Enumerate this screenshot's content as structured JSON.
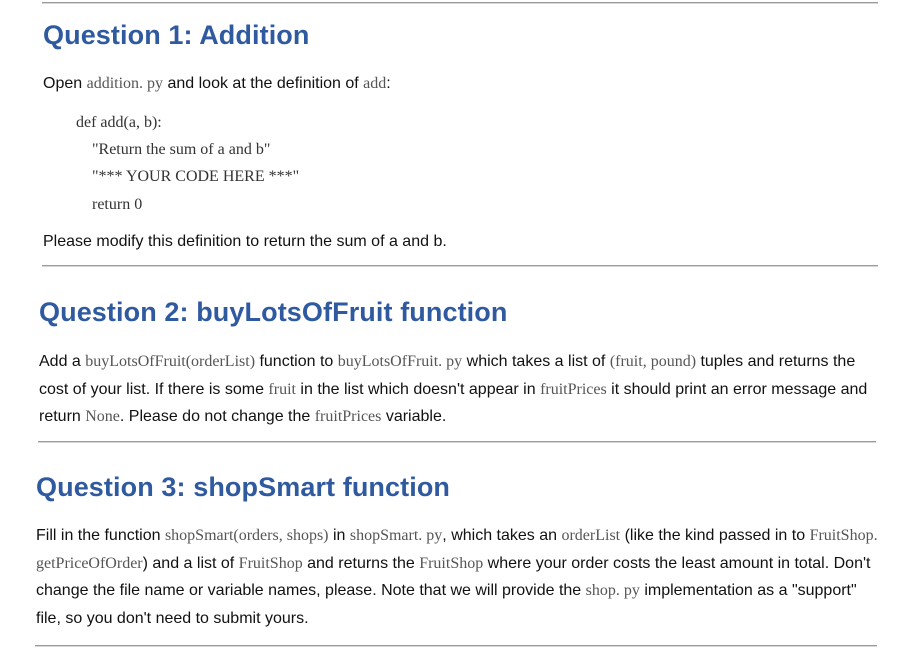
{
  "q1": {
    "title": "Question 1: Addition",
    "intro": {
      "t1": "Open ",
      "c1": "addition. py",
      "t2": " and look at the definition of ",
      "c2": "add",
      "t3": ":"
    },
    "code": [
      "def add(a, b):",
      "    \"Return the sum of a and b\"",
      "    \"*** YOUR CODE HERE ***\"",
      "    return 0"
    ],
    "outro": "Please modify this definition to return the sum of a and b."
  },
  "q2": {
    "title": "Question 2: buyLotsOfFruit function",
    "body": {
      "t1": "Add a ",
      "c1": "buyLotsOfFruit(orderList)",
      "t2": " function to ",
      "c2": "buyLotsOfFruit. py",
      "t3": " which takes a list of ",
      "c3": "(fruit, pound)",
      "t4": " tuples and returns the cost of your list. If there is some ",
      "c4": "fruit",
      "t5": " in the list which doesn't appear in ",
      "c5": "fruitPrices",
      "t6": " it should print an error message and return ",
      "c6": "None",
      "t7": ". Please do not change the ",
      "c7": "fruitPrices",
      "t8": " variable."
    }
  },
  "q3": {
    "title": "Question 3: shopSmart function",
    "body": {
      "t1": "Fill in the function ",
      "c1": "shopSmart(orders, shops)",
      "t2": " in ",
      "c2": "shopSmart. py",
      "t3": ", which takes an ",
      "c3": "orderList",
      "t4": " (like the kind passed in to ",
      "c4": "FruitShop. getPriceOfOrder",
      "t5": ") and a list of ",
      "c5": "FruitShop",
      "t6": " and returns the ",
      "c6": "FruitShop",
      "t7": " where your order costs the least amount in total. Don't change the file name or variable names, please. Note that we will provide the ",
      "c7": "shop. py",
      "t8": " implementation as a \"support\" file, so you don't need to submit yours."
    }
  }
}
